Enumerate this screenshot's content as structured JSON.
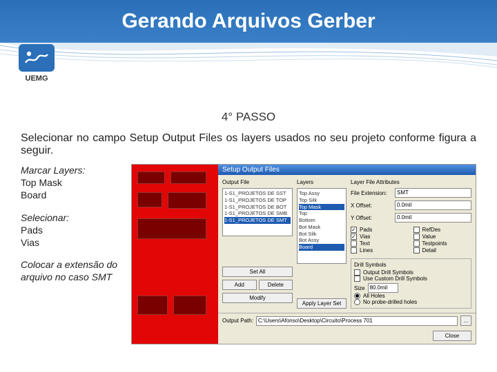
{
  "header": {
    "title": "Gerando Arquivos Gerber"
  },
  "logo": {
    "text": "UEMG"
  },
  "step": {
    "label": "4° PASSO",
    "desc": "Selecionar no campo Setup Output Files os layers usados no seu projeto conforme figura a seguir."
  },
  "instructions": {
    "markLayersTitle": "Marcar Layers:",
    "markLayers": [
      "Top Mask",
      "Board"
    ],
    "selectTitle": "Selecionar:",
    "selectItems": [
      "Pads",
      "Vias"
    ],
    "extNote": "Colocar a extensão do arquivo no caso SMT"
  },
  "dialog": {
    "title": "Setup Output Files",
    "outputFileLabel": "Output File",
    "outputFiles": [
      "1-S1_PROJETOS DE SST",
      "1-S1_PROJETOS DE TOP",
      "1-S1_PROJETOS DE BOT",
      "1-S1_PROJETOS DE SMB",
      "1-S1_PROJETOS DE SMT"
    ],
    "layersLabel": "Layers",
    "layers": [
      "Top Assy",
      "Top Silk",
      "Top Mask",
      "Top",
      "Bottom",
      "Bot Mask",
      "Bot Silk",
      "Bot Assy",
      "Board"
    ],
    "layersSelected": [
      "Top Mask",
      "Board"
    ],
    "buttons": {
      "setAll": "Set All",
      "add": "Add",
      "modify": "Modify",
      "delete": "Delete",
      "applyLayerSet": "Apply Layer Set",
      "close": "Close"
    },
    "fileAttrTitle": "Layer File Attributes",
    "fileExtLabel": "File Extension:",
    "fileExtValue": "SMT",
    "xoffLabel": "X Offset:",
    "xoffValue": "0.0mil",
    "yoffLabel": "Y Offset:",
    "yoffValue": "0.0mil",
    "checks": {
      "pads": "Pads",
      "refdes": "RefDes",
      "vias": "Vias",
      "value": "Value",
      "text": "Text",
      "testpoints": "Testpoints",
      "lines": "Lines",
      "detail": "Detail"
    },
    "drillGroup": {
      "title": "Drill Symbols",
      "optDefault": "Output Drill Symbols",
      "optCustom": "Use Custom Drill Symbols",
      "sizeLabel": "Size",
      "sizeValue": "80.0mil",
      "allHoles": "All Holes",
      "noProbe": "No probe-drilled holes"
    },
    "outputPathLabel": "Output Path:",
    "outputPathValue": "C:\\Users\\Afonso\\Desktop\\Circuito\\Process 701"
  }
}
